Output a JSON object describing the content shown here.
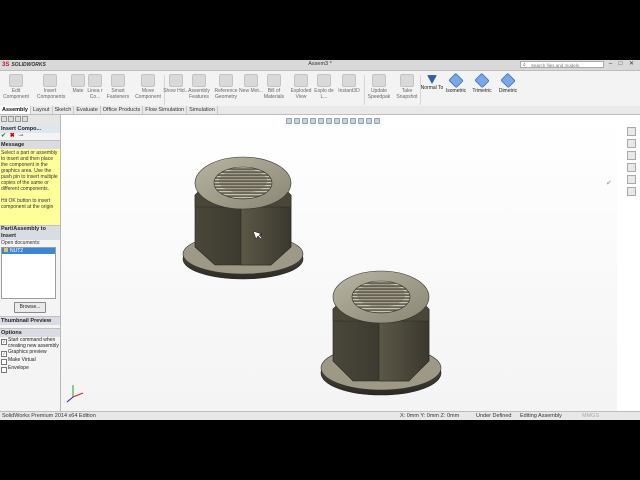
{
  "app": {
    "logo_text": "SOLIDWORKS",
    "document_title": "Assem3 *",
    "search_placeholder": "Search files and models"
  },
  "window_controls": {
    "minimize": "–",
    "maximize": "□",
    "close": "✕"
  },
  "commands": [
    {
      "id": "edit-component",
      "label": "Edit Component",
      "active": false
    },
    {
      "id": "insert-components",
      "label": "Insert Components",
      "active": false
    },
    {
      "id": "mate",
      "label": "Mate",
      "active": false
    },
    {
      "id": "linear-component",
      "label": "Linea r Co...",
      "active": false
    },
    {
      "id": "smart-fasteners",
      "label": "Smart Fasteners",
      "active": false
    },
    {
      "id": "move-component",
      "label": "Move Component",
      "active": false
    },
    {
      "id": "show-hidden",
      "label": "Show Hid...",
      "active": false
    },
    {
      "id": "assembly-features",
      "label": "Assembly Features",
      "active": false
    },
    {
      "id": "reference-geometry",
      "label": "Reference Geometry",
      "active": false
    },
    {
      "id": "new-motion",
      "label": "New Mot...",
      "active": false
    },
    {
      "id": "bill-of-materials",
      "label": "Bill of Materials",
      "active": false
    },
    {
      "id": "exploded-view",
      "label": "Exploded View",
      "active": false
    },
    {
      "id": "explode-line",
      "label": "Explo de L...",
      "active": false
    },
    {
      "id": "instant3d",
      "label": "Instant3D",
      "active": false
    },
    {
      "id": "update-speedpak",
      "label": "Update Speedpak",
      "active": false
    },
    {
      "id": "take-snapshot",
      "label": "Take Snapshot",
      "active": false
    },
    {
      "id": "normal-to",
      "label": "Normal To",
      "active": true
    },
    {
      "id": "isometric",
      "label": "Isometric",
      "active": true
    },
    {
      "id": "trimetric",
      "label": "Trimetric",
      "active": true
    },
    {
      "id": "dimetric",
      "label": "Dimetric",
      "active": true
    }
  ],
  "tabs": [
    "Assembly",
    "Layout",
    "Sketch",
    "Evaluate",
    "Office Products",
    "Flow Simulation",
    "Simulation"
  ],
  "active_tab": "Assembly",
  "property_manager": {
    "title": "Insert Compo...",
    "message_header": "Message",
    "message_text": "Select a part or assembly to insert and then place the component in the graphics area. Use the push pin to insert multiple copies of the same or different components.\n\nHit OK button to insert component at the origin",
    "part_section_header": "Part/Assembly to Insert",
    "open_documents_label": "Open documents:",
    "open_documents": [
      "NUT2"
    ],
    "browse_label": "Browse...",
    "thumbnail_header": "Thumbnail Preview",
    "options_header": "Options",
    "options": [
      {
        "label": "Start command when creating new assembly",
        "checked": true
      },
      {
        "label": "Graphics preview",
        "checked": true
      },
      {
        "label": "Make Virtual",
        "checked": false
      },
      {
        "label": "Envelope",
        "checked": false
      }
    ]
  },
  "status": {
    "edition": "SolidWorks Premium 2014 x64 Edition",
    "coordinates": "X: 0mm Y: 0mm Z: 0mm",
    "definition": "Under Defined",
    "mode": "Editing Assembly",
    "units": "MMGS"
  }
}
